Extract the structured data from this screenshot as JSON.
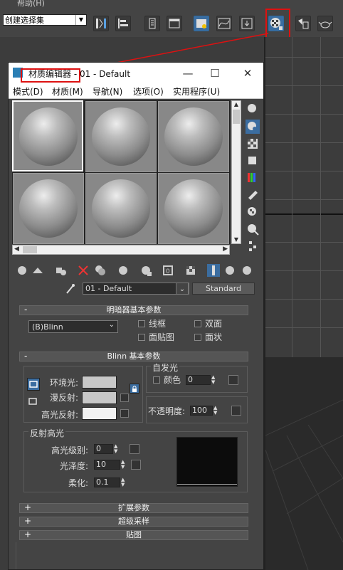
{
  "app": {
    "menu_item": "帮助(H)",
    "selection_set": "创建选择集"
  },
  "toolbar_icons": [
    "mirror-icon",
    "align-icon",
    "layer-manager-icon",
    "toggle-scene-explorer-icon",
    "curve-editor-icon",
    "schematic-view-icon",
    "material-editor-icon",
    "render-setup-icon",
    "rendered-frame-icon",
    "render-teapot-icon"
  ],
  "editor": {
    "title": "材质编辑器 - 01 - Default",
    "menus": [
      "模式(D)",
      "材质(M)",
      "导航(N)",
      "选项(O)",
      "实用程序(U)"
    ],
    "material_name": "01 - Default",
    "material_type": "Standard",
    "rollouts": {
      "shader_basic": "明暗器基本参数",
      "blinn_basic": "Blinn 基本参数",
      "extended": "扩展参数",
      "supersampling": "超级采样",
      "maps": "贴图"
    },
    "shader": {
      "type": "(B)Blinn",
      "wire": "线框",
      "two_sided": "双面",
      "face_map": "面贴图",
      "faceted": "面状"
    },
    "blinn": {
      "ambient_label": "环境光:",
      "diffuse_label": "漫反射:",
      "specular_label": "高光反射:",
      "self_illum_group": "自发光",
      "color_label": "颜色",
      "color_value": "0",
      "opacity_label": "不透明度:",
      "opacity_value": "100"
    },
    "specular_highlights": {
      "group": "反射高光",
      "level_label": "高光级别:",
      "level_value": "0",
      "gloss_label": "光泽度:",
      "gloss_value": "10",
      "soften_label": "柔化:",
      "soften_value": "0.1"
    },
    "colors": {
      "accent": "#d11a1a",
      "ambient": "#c8c8c8",
      "diffuse": "#c8c8c8",
      "specular": "#f2f2f2"
    }
  }
}
